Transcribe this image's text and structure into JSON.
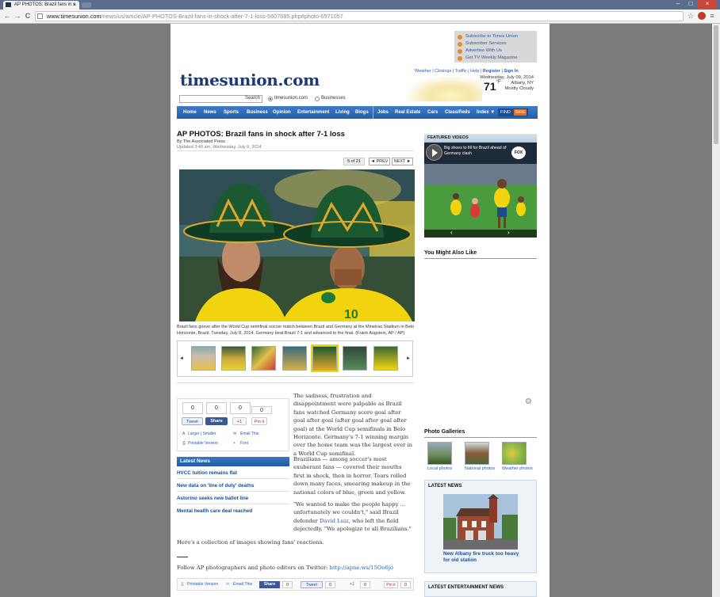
{
  "browser": {
    "tab_title": "AP PHOTOS: Brazil fans in s",
    "tab_close": "×",
    "url_host": "www.timesunion.com",
    "url_path": "/news/us/article/AP-PHOTOS-Brazil-fans-in-shock-after-7-1-loss-5607685.php#photo-6571057",
    "back": "←",
    "forward": "→",
    "reload": "C",
    "star": "☆",
    "menu": "≡",
    "win_min": "–",
    "win_max": "□",
    "win_close": "×"
  },
  "header": {
    "logo": "timesunion.com",
    "search_button": "Search",
    "search_scope_1": "timesunion.com",
    "search_scope_2": "Businesses",
    "subscribe_links": [
      "Subscribe to Times Union",
      "Subscriber Services",
      "Advertise With Us",
      "Get TV Weekly Magazine"
    ],
    "util_links": "Weather | Closings | Traffic | Help",
    "register": "Register",
    "sign_in": "Sign In",
    "weather_date": "Wednesday, July 09, 2014",
    "weather_temp": "71",
    "weather_unit": "°F",
    "weather_city": "Albany, NY",
    "weather_cond": "Mostly Cloudy"
  },
  "nav": {
    "items": [
      "Home",
      "News",
      "Sports",
      "Business",
      "Opinion",
      "Entertainment",
      "Living",
      "Blogs",
      "Jobs",
      "Real Estate",
      "Cars",
      "Classifieds",
      "Index ▼"
    ],
    "find": "FIND",
    "save": "SAVE"
  },
  "article": {
    "title": "AP PHOTOS: Brazil fans in shock after 7-1 loss",
    "byline": "By The Associated Press",
    "updated": "Updated 3:40 am, Wednesday, July 9, 2014",
    "photo_count": "5 of 21",
    "prev": "◄ PREV",
    "next": "NEXT ►",
    "caption": "Brazil fans grieve after the World Cup semifinal soccer match between Brazil and Germany at the Mineirao Stadium in Belo Horizonte, Brazil, Tuesday, July 8, 2014. Germany beat Brazil 7-1 and advanced to the final. (Frank Augstein, AP / AP)",
    "strip_prev": "◄",
    "strip_next": "►",
    "p1": "The sadness, frustration and disappointment were palpable as Brazil fans watched Germany score goal after goal after goal (after goal after goal after goal) at the World Cup semifinals in Belo Horizonte. Germany's 7-1 winning margin over the home team was the largest ever in a World Cup semifinal.",
    "p2": "Brazilians — among soccer's most exuberant fans — covered their mouths first in shock, then in horror. Tears rolled down many faces, smearing makeup in the national colors of blue, green and yellow.",
    "p3_a": "\"We wanted to make the people happy ... unfortunately we couldn't,\" said Brazil defender ",
    "p3_link": "David Luiz",
    "p3_b": ", who left the field dejectedly. \"We apologize to all Brazilians.\"",
    "p4": "Here's a collection of images showing fans' reactions.",
    "p5_a": "Follow AP photographers and photo editors on Twitter: ",
    "p5_link": "http://apne.ws/15Oo6jo"
  },
  "share": {
    "counts": [
      "0",
      "0",
      "0",
      "0"
    ],
    "tweet": "Tweet",
    "fb_share": "Share",
    "gplus": "+1",
    "pinit": "Pin it",
    "larger_smaller": "Larger | Smaller",
    "email_this": "Email This",
    "printable": "Printable Version",
    "font": "Font"
  },
  "latest": {
    "header": "Latest News",
    "items": [
      "HVCC tuition remains flat",
      "New data on 'line of duty' deaths",
      "Astorino seeks new ballot line",
      "Mental health care deal reached"
    ]
  },
  "bottom_share": {
    "printable": "Printable Version",
    "email": "Email This",
    "share": "Share",
    "tweet": "Tweet",
    "gplus": "+1",
    "pinit": "Pin it",
    "counts": [
      "0",
      "0",
      "0",
      "0"
    ]
  },
  "sidebar": {
    "featured_header": "FEATURED VIDEOS",
    "video_title": "Big shoes to fill for Brazil ahead of Germany clash",
    "fox": "FOX SPORTS",
    "vid_prev": "‹",
    "vid_next": "›",
    "ymal": "You Might Also Like",
    "galleries_header": "Photo Galleries",
    "galleries": [
      "Local photos",
      "National photos",
      "Weather photos"
    ],
    "latest_header": "LATEST NEWS",
    "latest_caption": "New Albany fire truck too heavy for old station",
    "ent_header": "LATEST ENTERTAINMENT NEWS"
  },
  "colors": {
    "brand_blue": "#1b3a74",
    "nav_blue": "#215ea9",
    "link_blue": "#2a5ca8",
    "brazil_yellow": "#f2d40e",
    "brazil_green": "#1f7a3a"
  }
}
